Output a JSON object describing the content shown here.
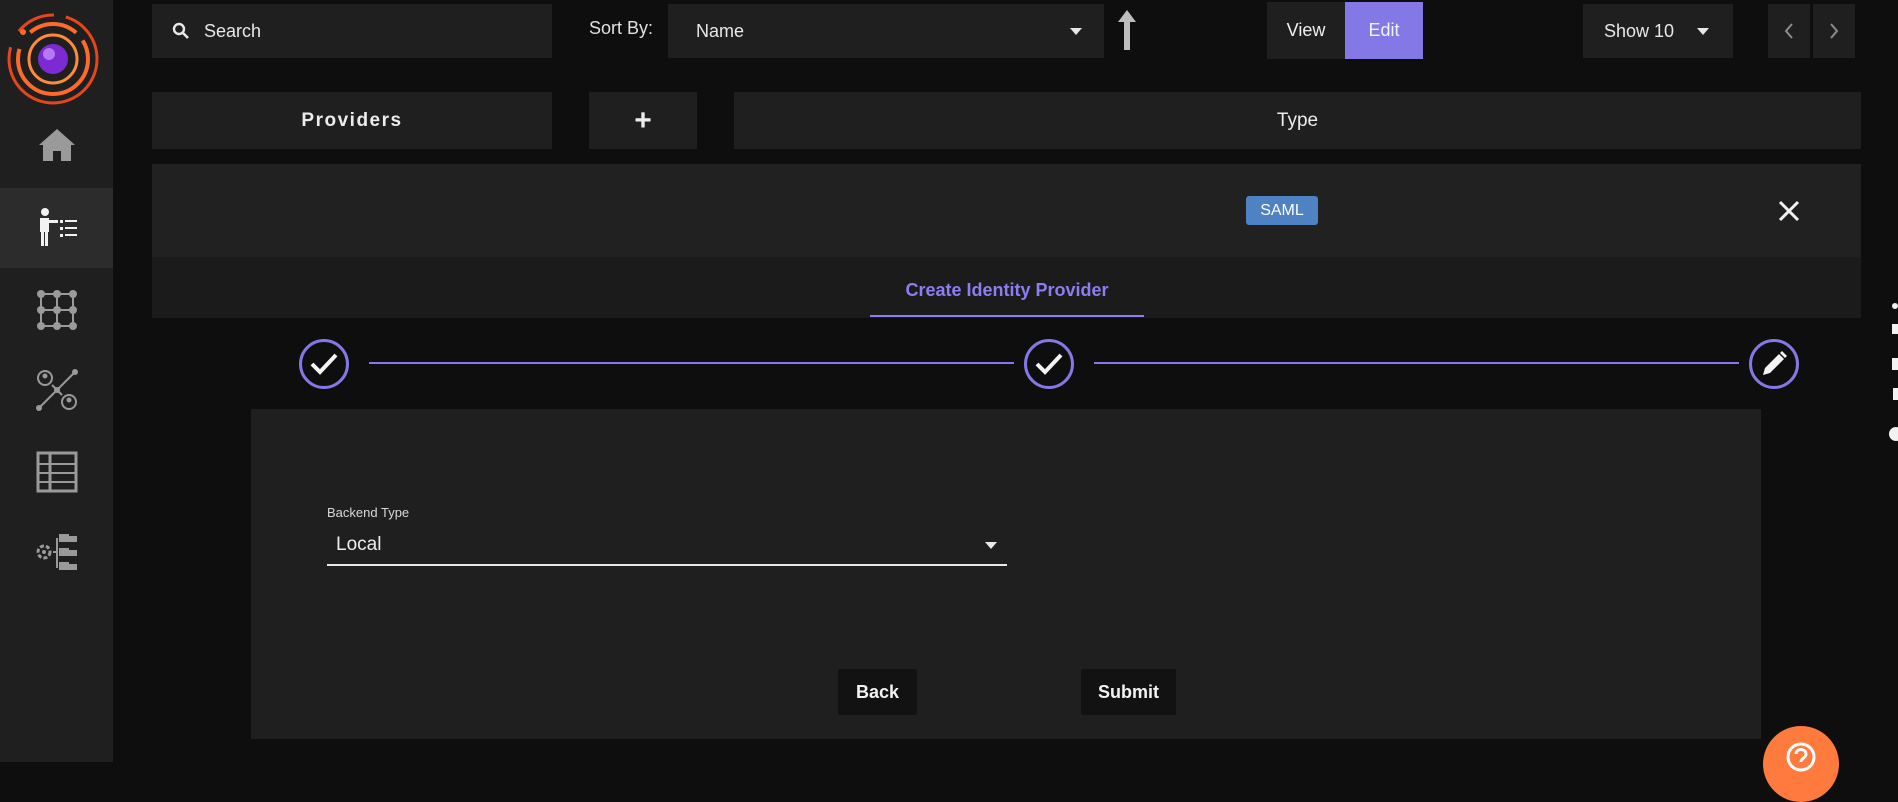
{
  "search": {
    "placeholder": "Search",
    "icon": "search-icon"
  },
  "sort": {
    "label": "Sort By:",
    "selected": "Name",
    "direction_icon": "arrow-up-icon"
  },
  "mode": {
    "view_label": "View",
    "edit_label": "Edit",
    "active": "Edit"
  },
  "page_size": {
    "selected": "Show 10"
  },
  "pager": {
    "prev_icon": "chevron-left-icon",
    "next_icon": "chevron-right-icon"
  },
  "columns": {
    "providers": "Providers",
    "add": "+",
    "type": "Type"
  },
  "row": {
    "badge": "SAML",
    "close_icon": "close-icon"
  },
  "tabs": {
    "create": "Create Identity Provider"
  },
  "stepper": {
    "steps": [
      {
        "state": "complete",
        "icon": "check-icon"
      },
      {
        "state": "complete",
        "icon": "check-icon"
      },
      {
        "state": "active",
        "icon": "pencil-icon"
      }
    ]
  },
  "form": {
    "backend_type": {
      "label": "Backend Type",
      "value": "Local"
    },
    "back_label": "Back",
    "submit_label": "Submit"
  },
  "sidebar": {
    "items": [
      {
        "icon": "home-icon"
      },
      {
        "icon": "user-list-icon",
        "active": true
      },
      {
        "icon": "grid-dots-icon"
      },
      {
        "icon": "user-network-icon"
      },
      {
        "icon": "table-icon"
      },
      {
        "icon": "gear-tree-icon"
      }
    ]
  },
  "help": {
    "icon": "help-icon"
  },
  "colors": {
    "accent": "#8478e6",
    "badge": "#4e82c3",
    "help": "#ff7a3d",
    "panel": "#1f1f1f",
    "background": "#0e0e0e"
  }
}
